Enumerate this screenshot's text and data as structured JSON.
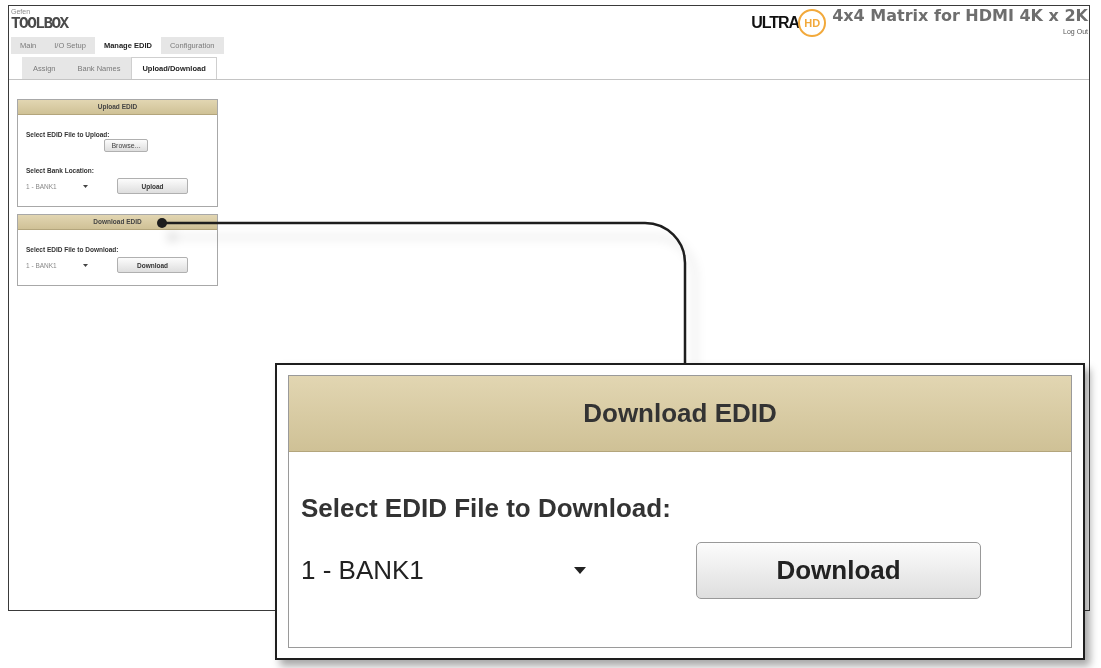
{
  "header": {
    "brand_small": "Gefen",
    "logo": "TOOLBOX",
    "logo_badge": {
      "ultra": "ULTRA",
      "hd": "HD"
    },
    "title": "4x4 Matrix for HDMI 4K x 2K",
    "logout": "Log Out"
  },
  "tabs": [
    {
      "label": "Main",
      "selected": false
    },
    {
      "label": "I/O Setup",
      "selected": false
    },
    {
      "label": "Manage EDID",
      "selected": true
    },
    {
      "label": "Configuration",
      "selected": false
    }
  ],
  "subtabs": [
    {
      "label": "Assign",
      "selected": false
    },
    {
      "label": "Bank Names",
      "selected": false
    },
    {
      "label": "Upload/Download",
      "selected": true
    }
  ],
  "panels": [
    {
      "title": "Upload EDID",
      "items": [
        {
          "kind": "label",
          "text": "Select EDID File to Upload:"
        },
        {
          "kind": "file_button",
          "text": "Browse..."
        },
        {
          "kind": "label",
          "text": "Select Bank Location:"
        },
        {
          "kind": "select_action",
          "value": "1 - BANK1",
          "button": "Upload"
        }
      ]
    },
    {
      "title": "Download EDID",
      "items": [
        {
          "kind": "label",
          "text": "Select EDID File to Download:"
        },
        {
          "kind": "select_action",
          "value": "1 - BANK1",
          "button": "Download"
        }
      ]
    }
  ],
  "callout": {
    "title": "Download EDID",
    "items": [
      {
        "kind": "label",
        "text": "Select EDID File to Download:"
      },
      {
        "kind": "select_action",
        "value": "1 - BANK1",
        "button": "Download"
      }
    ]
  }
}
